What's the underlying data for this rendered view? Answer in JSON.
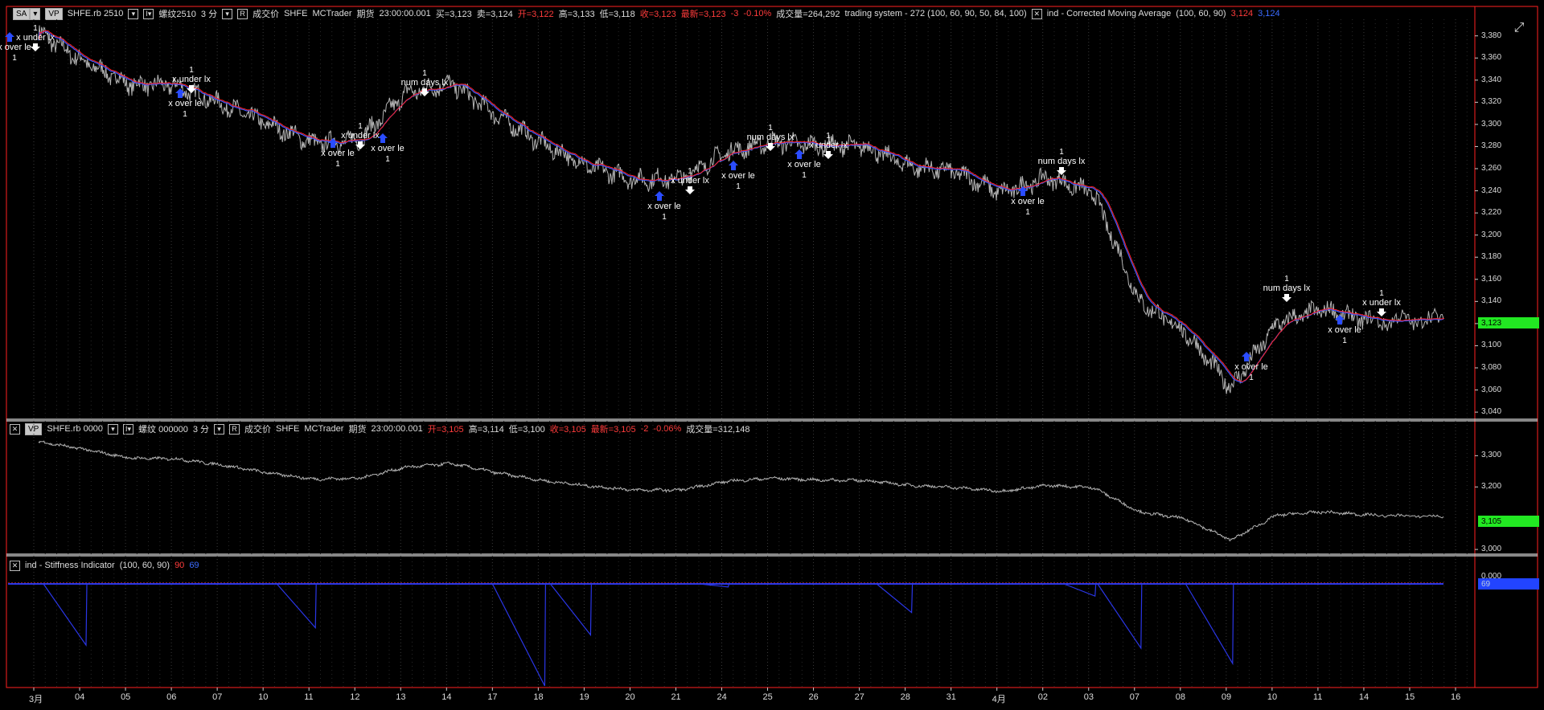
{
  "header1": {
    "btn_sa": "SA",
    "btn_vp": "VP",
    "symbol": "SHFE.rb 2510",
    "name": "螺纹2510",
    "interval": "3 分",
    "r_btn": "R",
    "mode": "成交价",
    "exchange": "SHFE",
    "source": "MCTrader",
    "kind": "期货",
    "time": "23:00:00.001",
    "buy": "买=3,123",
    "sell": "卖=3,124",
    "open": "开=3,122",
    "high": "高=3,133",
    "low": "低=3,118",
    "close": "收=3,123",
    "last": "最新=3,123",
    "chg": "-3",
    "pct": "-0.10%",
    "vol": "成交量=264,292",
    "system": "trading system - 272  (100,  60,  90,  50,  84,  100)",
    "ind_name": "ind - Corrected Moving Average",
    "ind_params": "(100,  60,  90)",
    "ind_v1": "3,124",
    "ind_v2": "3,124"
  },
  "header2": {
    "btn_vp": "VP",
    "symbol": "SHFE.rb 0000",
    "name": "螺纹 000000",
    "interval": "3 分",
    "r_btn": "R",
    "mode": "成交价",
    "exchange": "SHFE",
    "source": "MCTrader",
    "kind": "期货",
    "time": "23:00:00.001",
    "open": "开=3,105",
    "high": "高=3,114",
    "low": "低=3,100",
    "close": "收=3,105",
    "last": "最新=3,105",
    "chg": "-2",
    "pct": "-0.06%",
    "vol": "成交量=312,148"
  },
  "header3": {
    "ind_name": "ind - Stiffness Indicator",
    "ind_params": "(100,  60,  90)",
    "v1": "90",
    "v2": "69"
  },
  "axis1": {
    "ticks": [
      3380,
      3360,
      3340,
      3320,
      3300,
      3280,
      3260,
      3240,
      3220,
      3200,
      3180,
      3160,
      3140,
      3120,
      3100,
      3080,
      3060,
      3040
    ],
    "tick_labels": [
      "3,380",
      "3,360",
      "3,340",
      "3,320",
      "3,300",
      "3,280",
      "3,260",
      "3,240",
      "3,220",
      "3,200",
      "3,180",
      "3,160",
      "3,140",
      "3,120",
      "3,100",
      "3,080",
      "3,060",
      "3,040"
    ],
    "ylim": [
      3035,
      3395
    ],
    "last_tag": "3,123"
  },
  "axis2": {
    "ticks": [
      3300,
      3200,
      3000
    ],
    "tick_labels": [
      "3,300",
      "3,200",
      "3,000"
    ],
    "ylim": [
      2990,
      3360
    ],
    "last_tag": "3,105"
  },
  "axis3": {
    "tick_labels": [
      "0.000"
    ],
    "last_tag": "69"
  },
  "x_labels": [
    "3月",
    "04",
    "05",
    "06",
    "07",
    "10",
    "11",
    "12",
    "13",
    "14",
    "17",
    "18",
    "19",
    "20",
    "21",
    "24",
    "25",
    "26",
    "27",
    "28",
    "31",
    "4月",
    "02",
    "03",
    "07",
    "08",
    "09",
    "10",
    "11",
    "14",
    "15",
    "16"
  ],
  "colors": {
    "price": "#b4b4b4",
    "ma_red": "#ff2020",
    "ma_blue": "#3a5aff",
    "stiff": "#2a36e6",
    "tag": "#22e822",
    "frame": "#ff2020"
  },
  "chart_data": {
    "type": "line",
    "series": [
      {
        "name": "SHFE.rb 2510",
        "x": [
          "3月",
          "04",
          "05",
          "06",
          "07",
          "10",
          "11",
          "12",
          "13",
          "14",
          "17",
          "18",
          "19",
          "20",
          "21",
          "24",
          "25",
          "26",
          "27",
          "28",
          "31",
          "4月",
          "02",
          "03",
          "07",
          "08",
          "09",
          "10",
          "11",
          "14",
          "15"
        ],
        "values": [
          3383,
          3356,
          3336,
          3335,
          3318,
          3300,
          3283,
          3286,
          3328,
          3337,
          3308,
          3282,
          3262,
          3250,
          3251,
          3275,
          3284,
          3281,
          3280,
          3262,
          3257,
          3238,
          3252,
          3238,
          3140,
          3112,
          3062,
          3120,
          3133,
          3122,
          3124
        ]
      },
      {
        "name": "SHFE.rb 0000",
        "x": [
          "3月",
          "04",
          "05",
          "06",
          "07",
          "10",
          "11",
          "12",
          "13",
          "14",
          "17",
          "18",
          "19",
          "20",
          "21",
          "24",
          "25",
          "26",
          "27",
          "28",
          "31",
          "4月",
          "02",
          "03",
          "07",
          "08",
          "09",
          "10",
          "11",
          "14",
          "15"
        ],
        "values": [
          3345,
          3320,
          3292,
          3290,
          3270,
          3245,
          3225,
          3228,
          3263,
          3275,
          3245,
          3220,
          3203,
          3190,
          3190,
          3218,
          3228,
          3222,
          3221,
          3205,
          3198,
          3186,
          3205,
          3198,
          3120,
          3098,
          3030,
          3110,
          3120,
          3110,
          3105
        ]
      },
      {
        "name": "ind - Stiffness Indicator",
        "type": "spikes",
        "events": [
          {
            "x": "04",
            "depth": 0.6
          },
          {
            "x": "11",
            "depth": 0.43
          },
          {
            "x": "18",
            "depth": 1.0
          },
          {
            "x": "19",
            "depth": 0.5
          },
          {
            "x": "24",
            "depth": 0.03
          },
          {
            "x": "28",
            "depth": 0.28
          },
          {
            "x": "03",
            "depth": 0.12
          },
          {
            "x": "07",
            "depth": 0.63
          },
          {
            "x": "09",
            "depth": 0.78
          }
        ]
      }
    ],
    "annotations": [
      {
        "x": "3月",
        "text": "x over le"
      },
      {
        "x": "3月",
        "text": "x under lx"
      },
      {
        "x": "06",
        "text": "x over le"
      },
      {
        "x": "06",
        "text": "x under lx"
      },
      {
        "x": "12",
        "text": "x over le"
      },
      {
        "x": "12",
        "text": "x under lx"
      },
      {
        "x": "12",
        "text": "x over le"
      },
      {
        "x": "13",
        "text": "num days lx"
      },
      {
        "x": "20",
        "text": "x over le"
      },
      {
        "x": "21",
        "text": "x under lx"
      },
      {
        "x": "24",
        "text": "x over le"
      },
      {
        "x": "25",
        "text": "num days lx"
      },
      {
        "x": "25",
        "text": "x over le"
      },
      {
        "x": "26",
        "text": "x under lx"
      },
      {
        "x": "4月",
        "text": "x over le"
      },
      {
        "x": "02",
        "text": "num days lx"
      },
      {
        "x": "09",
        "text": "x over le"
      },
      {
        "x": "10",
        "text": "num days lx"
      },
      {
        "x": "14",
        "text": "x over le"
      },
      {
        "x": "14",
        "text": "x under lx"
      }
    ],
    "annotation_qty": "1"
  }
}
